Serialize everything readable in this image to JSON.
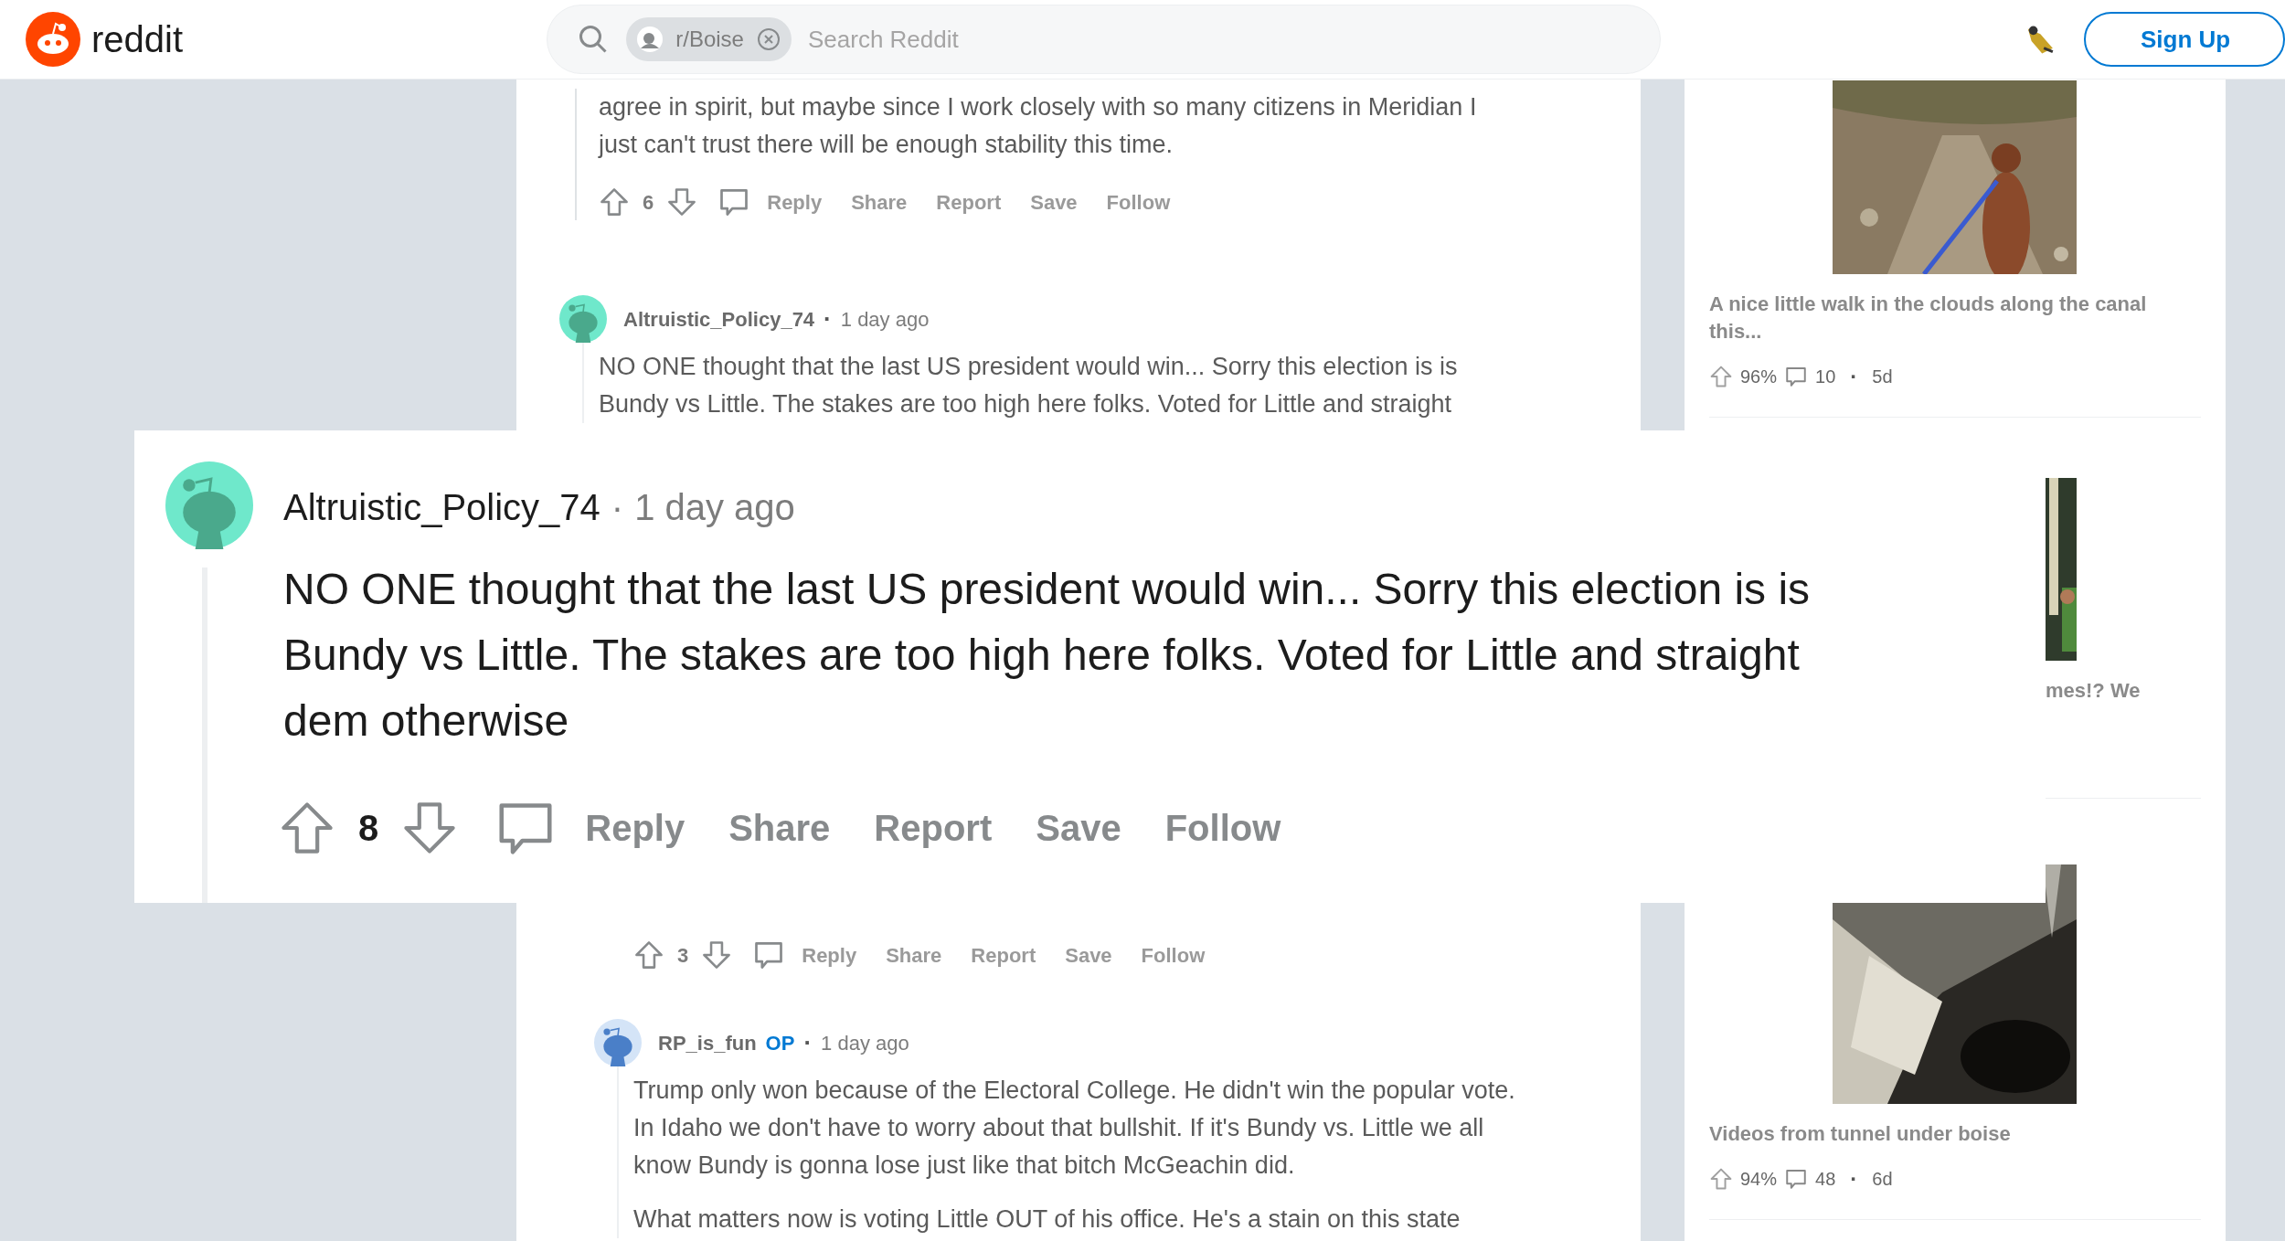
{
  "header": {
    "logo": "reddit",
    "search_chip": "r/Boise",
    "search_placeholder": "Search Reddit",
    "sign_up": "Sign Up"
  },
  "thread": [
    {
      "kind": "tail",
      "body": [
        "agree in spirit, but maybe since I work closely with so many citizens in Meridian I just can't trust there will be enough stability this time."
      ],
      "votes": "6",
      "actions": [
        "Reply",
        "Share",
        "Report",
        "Save",
        "Follow"
      ]
    },
    {
      "kind": "comment",
      "author": "Altruistic_Policy_74",
      "separator": "·",
      "time": "1 day ago",
      "body": [
        "NO ONE thought that the last US president would win... Sorry this election is is Bundy vs Little. The stakes are too high here folks. Voted for Little and straight"
      ],
      "children": [
        {
          "kind": "tail",
          "votes": "3",
          "actions": [
            "Reply",
            "Share",
            "Report",
            "Save",
            "Follow"
          ]
        },
        {
          "kind": "comment",
          "author": "RP_is_fun",
          "op": "OP",
          "separator": "·",
          "time": "1 day ago",
          "body": [
            "Trump only won because of the Electoral College. He didn't win the popular vote. In Idaho we don't have to worry about that bullshit. If it's Bundy vs. Little we all know Bundy is gonna lose just like that bitch McGeachin did.",
            "What matters now is voting Little OUT of his office. He's a stain on this state"
          ]
        }
      ]
    }
  ],
  "sidebar": [
    {
      "title": "A nice little walk in the clouds along the canal this...",
      "upvotes": "96%",
      "comments": "10",
      "separator": "·",
      "age": "5d"
    },
    {
      "title": "mes!? We"
    },
    {
      "title": "Videos from tunnel under boise",
      "upvotes": "94%",
      "comments": "48",
      "separator": "·",
      "age": "6d"
    }
  ],
  "focus_comment": {
    "author": "Altruistic_Policy_74",
    "separator": "·",
    "time": "1 day ago",
    "body": "NO ONE thought that the last US president would win... Sorry this election is is Bundy vs Little. The stakes are too high here folks. Voted for Little and straight dem otherwise",
    "votes": "8",
    "actions": [
      "Reply",
      "Share",
      "Report",
      "Save",
      "Follow"
    ]
  }
}
